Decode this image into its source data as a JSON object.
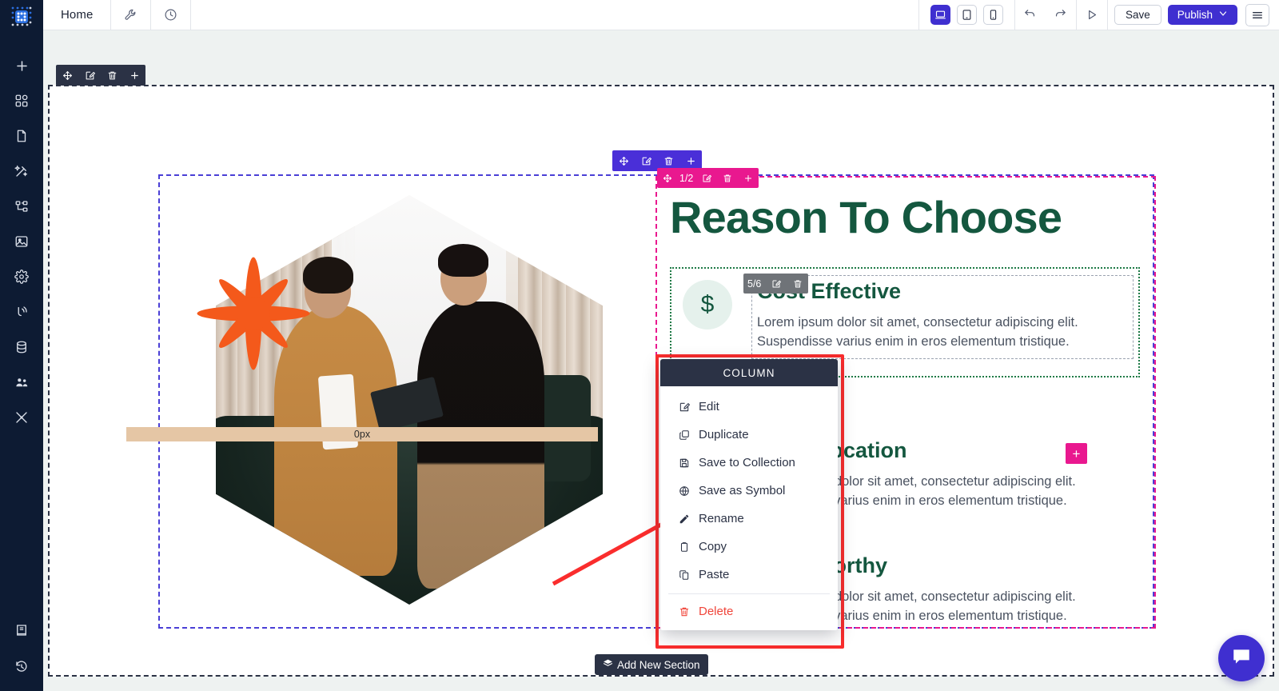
{
  "app": {
    "logo_icon": "grid-dots-logo-icon"
  },
  "topbar": {
    "home_label": "Home",
    "tools_icon": "wrench-icon",
    "history_icon": "clock-icon",
    "devices": [
      {
        "name": "desktop",
        "icon": "desktop-icon",
        "active": true
      },
      {
        "name": "tablet",
        "icon": "tablet-icon",
        "active": false
      },
      {
        "name": "mobile",
        "icon": "mobile-icon",
        "active": false
      }
    ],
    "undo_icon": "undo-icon",
    "redo_icon": "redo-icon",
    "preview_icon": "play-preview-icon",
    "save_label": "Save",
    "publish_label": "Publish",
    "publish_caret_icon": "chevron-down-icon",
    "menu_icon": "hamburger-menu-icon",
    "accent_color": "#3f2fd0"
  },
  "sidebar": {
    "items": [
      {
        "name": "add",
        "icon": "plus-icon"
      },
      {
        "name": "widgets",
        "icon": "blocks-icon"
      },
      {
        "name": "pages",
        "icon": "page-icon"
      },
      {
        "name": "design",
        "icon": "magic-wand-icon"
      },
      {
        "name": "layers",
        "icon": "sitemap-icon"
      },
      {
        "name": "media",
        "icon": "image-icon"
      },
      {
        "name": "settings",
        "icon": "gear-icon"
      },
      {
        "name": "publish-status",
        "icon": "broadcast-icon"
      },
      {
        "name": "database",
        "icon": "database-icon"
      },
      {
        "name": "users",
        "icon": "users-icon"
      },
      {
        "name": "tools",
        "icon": "tools-icon"
      }
    ],
    "bottom_items": [
      {
        "name": "docs",
        "icon": "book-icon"
      },
      {
        "name": "revision-history",
        "icon": "restore-clock-icon"
      }
    ]
  },
  "section_toolbar": {
    "buttons": [
      {
        "name": "move",
        "icon": "move-arrows-icon"
      },
      {
        "name": "edit",
        "icon": "edit-pencil-square-icon"
      },
      {
        "name": "delete",
        "icon": "trash-icon"
      },
      {
        "name": "add",
        "icon": "plus-icon"
      }
    ]
  },
  "column_badge_purple": {
    "buttons": [
      {
        "name": "move",
        "icon": "move-arrows-icon"
      },
      {
        "name": "edit",
        "icon": "edit-pencil-square-icon"
      },
      {
        "name": "delete",
        "icon": "trash-icon"
      },
      {
        "name": "add",
        "icon": "plus-icon"
      }
    ]
  },
  "column_badge_pink": {
    "fraction": "1/2",
    "buttons": [
      {
        "name": "move",
        "icon": "move-arrows-icon"
      },
      {
        "name": "edit",
        "icon": "edit-pencil-square-icon"
      },
      {
        "name": "delete",
        "icon": "trash-icon"
      },
      {
        "name": "add",
        "icon": "plus-icon"
      }
    ]
  },
  "element_badge_grey": {
    "fraction": "5/6",
    "buttons": [
      {
        "name": "edit",
        "icon": "edit-pencil-square-icon"
      },
      {
        "name": "delete",
        "icon": "trash-icon"
      }
    ]
  },
  "drop_indicator": {
    "label": "0px",
    "color": "#e5c6a5"
  },
  "add_plus_button": {
    "label": "+",
    "color": "#e9188f"
  },
  "add_section_button": {
    "label": "Add New Section",
    "icon": "layers-stack-icon"
  },
  "page_content": {
    "heading": "Reason To Choose",
    "features": [
      {
        "icon": "dollar-sign-icon",
        "icon_glyph": "$",
        "title": "Cost Effective",
        "body": "Lorem ipsum dolor sit amet, consectetur adipiscing elit. Suspendisse varius enim in eros elementum tristique."
      },
      {
        "title": "Great Location",
        "body": "Lorem ipsum dolor sit amet, consectetur adipiscing elit. Suspendisse varius enim in eros elementum tristique."
      },
      {
        "title": "Trust Worthy",
        "body": "Lorem ipsum dolor sit amet, consectetur adipiscing elit. Suspendisse varius enim in eros elementum tristique."
      }
    ],
    "image": {
      "name": "hexagon-people-photo",
      "alt": "Two people seated on a dark green sofa reviewing a tablet",
      "star_burst_color": "#f4591b"
    },
    "heading_color": "#14573f"
  },
  "context_menu": {
    "title": "COLUMN",
    "items": [
      {
        "label": "Edit",
        "icon": "edit-pencil-square-icon",
        "danger": false
      },
      {
        "label": "Duplicate",
        "icon": "duplicate-icon",
        "danger": false
      },
      {
        "label": "Save to Collection",
        "icon": "save-disk-icon",
        "danger": false
      },
      {
        "label": "Save as Symbol",
        "icon": "globe-icon",
        "danger": false
      },
      {
        "label": "Rename",
        "icon": "pencil-icon",
        "danger": false
      },
      {
        "label": "Copy",
        "icon": "clipboard-icon",
        "danger": false
      },
      {
        "label": "Paste",
        "icon": "paste-icon",
        "danger": false
      },
      {
        "label": "Delete",
        "icon": "trash-icon",
        "danger": true
      }
    ],
    "highlight_color": "#fa2d2d"
  },
  "annotation": {
    "arrow_color": "#fa2d2d"
  },
  "chat_widget": {
    "icon": "chat-bubble-icon",
    "color": "#3f2fd0"
  }
}
